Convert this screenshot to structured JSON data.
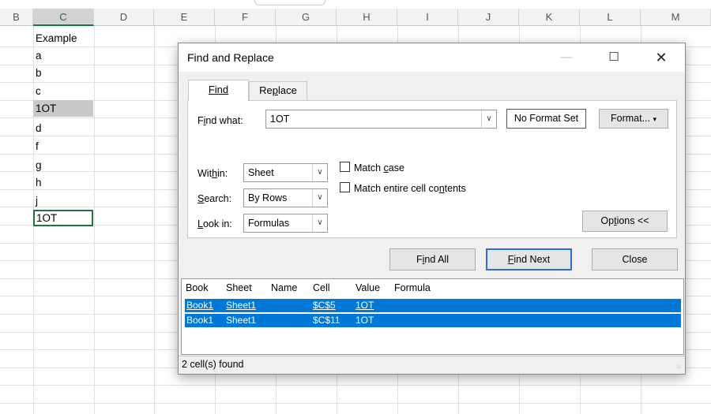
{
  "sheet": {
    "columns": [
      "B",
      "C",
      "D",
      "E",
      "F",
      "G",
      "H",
      "I",
      "J",
      "K",
      "L",
      "M"
    ],
    "selected_column": "C",
    "cells_c": [
      "Example",
      "a",
      "b",
      "c",
      "1OT",
      "d",
      "f",
      "g",
      "h",
      "j",
      "1OT"
    ]
  },
  "dialog": {
    "title": "Find and Replace",
    "min_icon": "—",
    "max_icon": "☐",
    "close_icon": "✕",
    "tabs": {
      "find": "Find",
      "replace": "Replace"
    },
    "find_what_label": "Find what:",
    "find_what_value": "1OT",
    "no_format_label": "No Format Set",
    "format_button": "Format...",
    "within_label": "Within:",
    "within_value": "Sheet",
    "search_label": "Search:",
    "search_value": "By Rows",
    "lookin_label": "Look in:",
    "lookin_value": "Formulas",
    "match_case_label": "Match case",
    "match_entire_label": "Match entire cell contents",
    "options_button": "Options <<",
    "find_all_button": "Find All",
    "find_next_button": "Find Next",
    "close_button": "Close",
    "results_headers": [
      "Book",
      "Sheet",
      "Name",
      "Cell",
      "Value",
      "Formula"
    ],
    "results_rows": [
      {
        "book": "Book1",
        "sheet": "Sheet1",
        "name": "",
        "cell": "$C$5",
        "value": "1OT",
        "formula": ""
      },
      {
        "book": "Book1",
        "sheet": "Sheet1",
        "name": "",
        "cell": "$C$11",
        "value": "1OT",
        "formula": ""
      }
    ],
    "status": "2 cell(s) found",
    "colors": {
      "selection": "#0078d7",
      "default_button_border": "#2a6fd6",
      "excel_green": "#107c41"
    }
  }
}
